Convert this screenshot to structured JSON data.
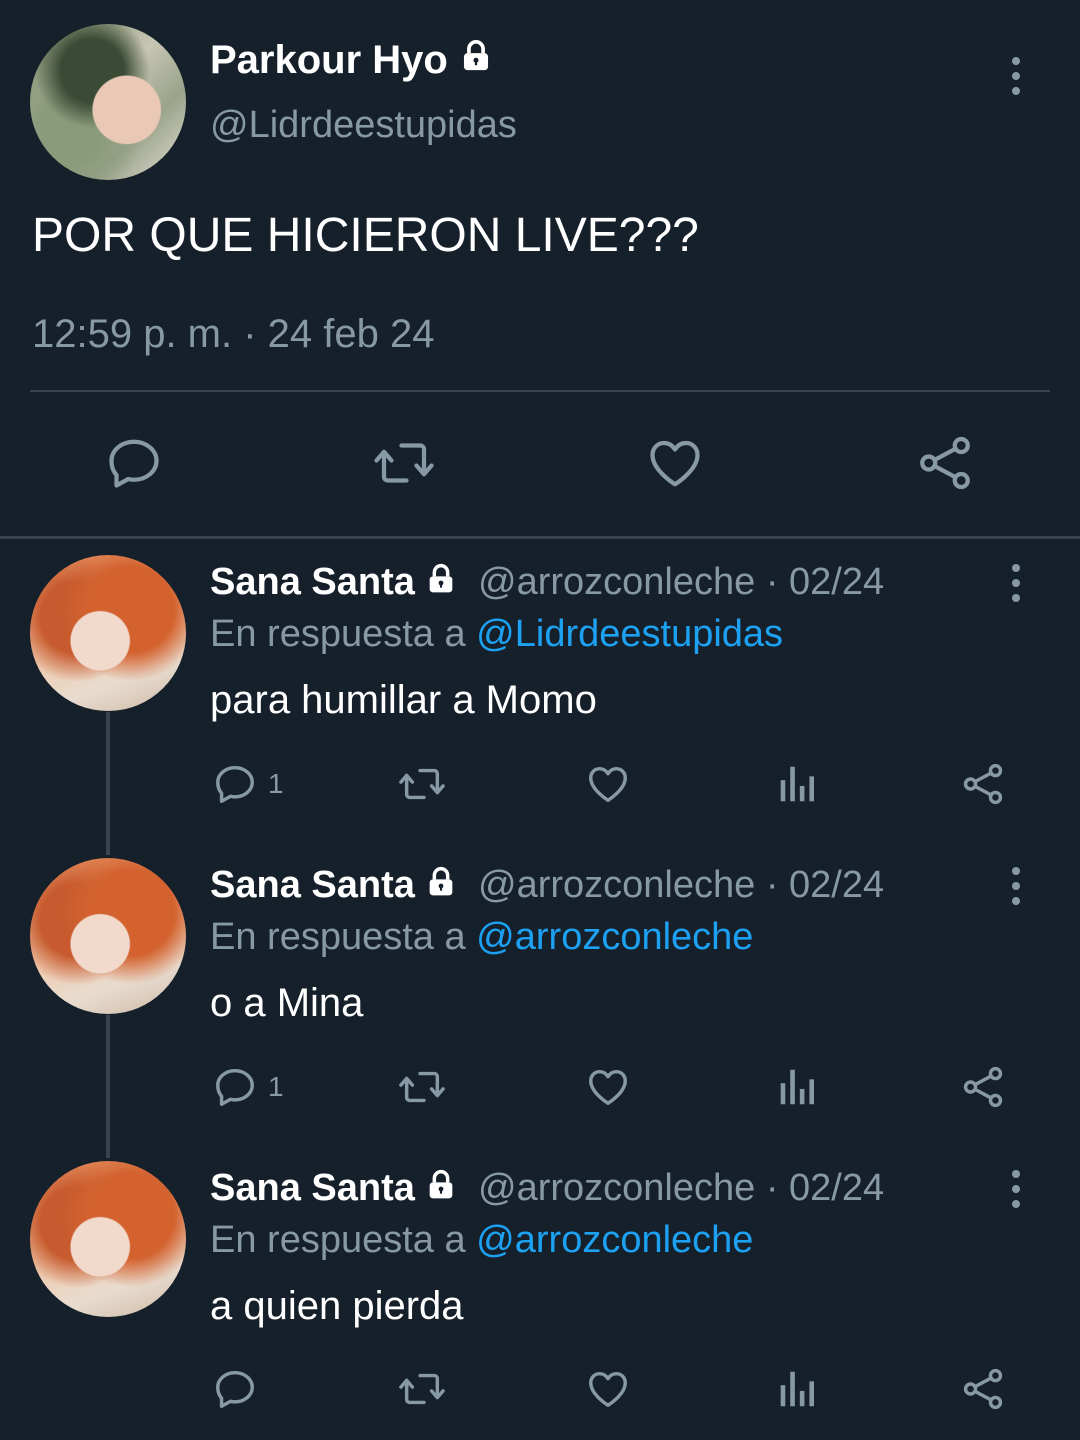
{
  "main_tweet": {
    "display_name": "Parkour Hyo",
    "handle": "@Lidrdeestupidas",
    "text": "POR QUE HICIERON LIVE???",
    "timestamp": "12:59 p. m. · 24 feb 24",
    "actions": [
      "reply-icon",
      "retweet-icon",
      "like-icon",
      "share-icon"
    ]
  },
  "replies": [
    {
      "display_name": "Sana Santa",
      "handle": "@arrozconleche",
      "date": "· 02/24",
      "reply_prefix": "En respuesta a ",
      "reply_to": "@Lidrdeestupidas",
      "text": "para humillar a Momo",
      "reply_count": "1"
    },
    {
      "display_name": "Sana Santa",
      "handle": "@arrozconleche",
      "date": "· 02/24",
      "reply_prefix": "En respuesta a ",
      "reply_to": "@arrozconleche",
      "text": "o a Mina",
      "reply_count": "1"
    },
    {
      "display_name": "Sana Santa",
      "handle": "@arrozconleche",
      "date": "· 02/24",
      "reply_prefix": "En respuesta a ",
      "reply_to": "@arrozconleche",
      "text": "a quien pierda",
      "reply_count": ""
    }
  ],
  "colors": {
    "background": "#15202b",
    "secondary_text": "#8899a6",
    "link": "#1da1f2",
    "divider": "#38444d"
  }
}
